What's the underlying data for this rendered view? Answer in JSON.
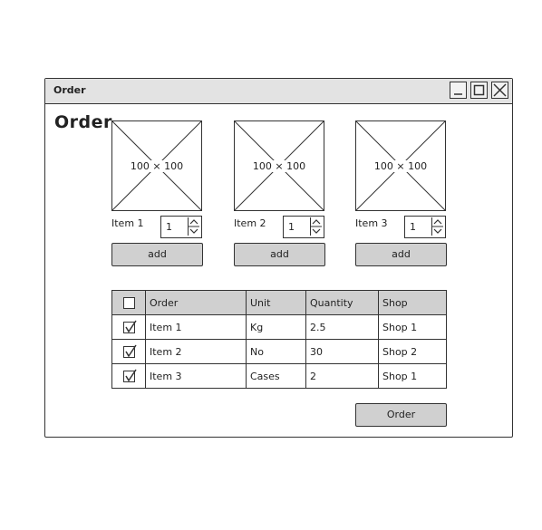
{
  "window": {
    "title": "Order"
  },
  "heading": "Order",
  "items": [
    {
      "placeholder": "100 × 100",
      "label": "Item 1",
      "quantity": "1",
      "add_label": "add"
    },
    {
      "placeholder": "100 × 100",
      "label": "Item 2",
      "quantity": "1",
      "add_label": "add"
    },
    {
      "placeholder": "100 × 100",
      "label": "Item 3",
      "quantity": "1",
      "add_label": "add"
    }
  ],
  "table": {
    "columns": [
      "Order",
      "Unit",
      "Quantity",
      "Shop"
    ],
    "rows": [
      {
        "checked": true,
        "order": "Item 1",
        "unit": "Kg",
        "quantity": "2.5",
        "shop": "Shop 1"
      },
      {
        "checked": true,
        "order": "Item 2",
        "unit": "No",
        "quantity": "30",
        "shop": "Shop 2"
      },
      {
        "checked": true,
        "order": "Item 3",
        "unit": "Cases",
        "quantity": "2",
        "shop": "Shop 1"
      }
    ]
  },
  "order_button_label": "Order"
}
